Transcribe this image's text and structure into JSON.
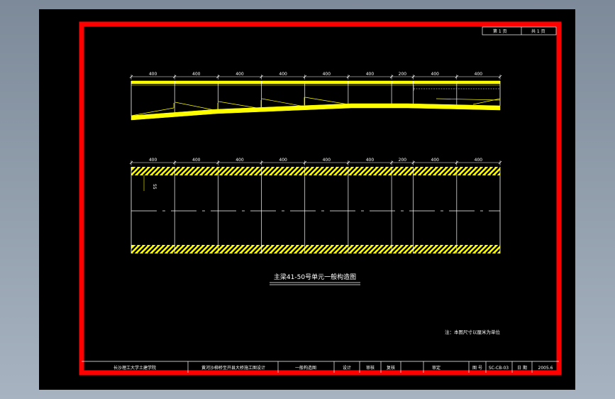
{
  "sheet": {
    "page_no": "第 1 页",
    "page_total": "共 1 页",
    "frame_color": "#ff0000",
    "line_color": "#ffff00",
    "text_color": "#ffffff",
    "background": "#000000"
  },
  "elevation": {
    "dimensions": [
      "400",
      "400",
      "400",
      "400",
      "400",
      "400",
      "200",
      "400",
      "400"
    ]
  },
  "plan": {
    "dimensions": [
      "400",
      "400",
      "400",
      "400",
      "400",
      "400",
      "200",
      "400",
      "400"
    ],
    "side_dim": "55"
  },
  "drawing_title": "主梁41-50号单元一般构造图",
  "note": "注：本图尺寸以厘米为单位",
  "title_block": {
    "school": "长沙理工大学土建学院",
    "project": "黄河沙柳桥至开县大桥施工图设计",
    "drawing_name": "一般构造图",
    "design": "设计",
    "review": "审核",
    "check": "复核",
    "approve": "审定",
    "figure_no_label": "图 号",
    "figure_no": "SC-CB-03",
    "date_label": "日 期",
    "date": "2005.6"
  }
}
